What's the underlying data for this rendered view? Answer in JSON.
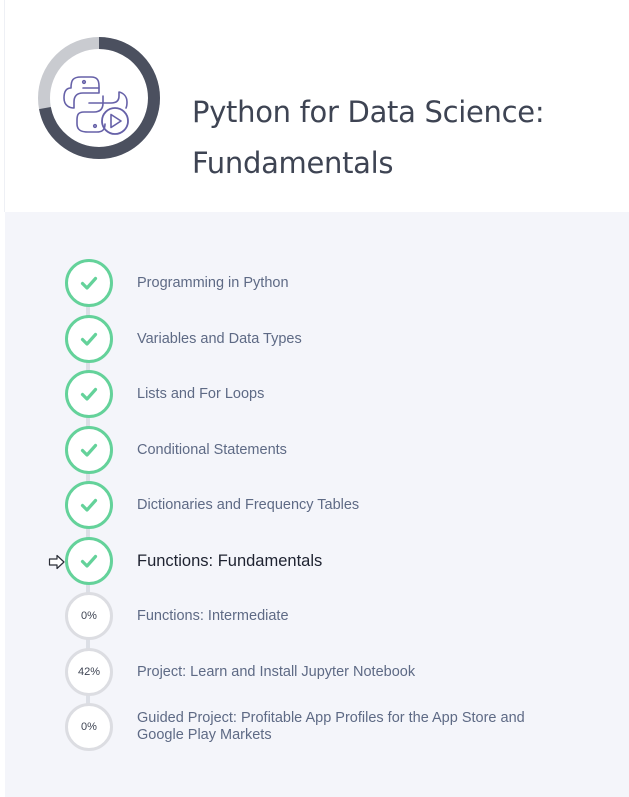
{
  "course": {
    "title_line1": "Python for Data Science:",
    "title_line2": "Fundamentals",
    "progress_fraction": 0.72,
    "colors": {
      "ring_progress": "#4b505f",
      "ring_track": "#c9cbd0",
      "icon_stroke": "#6661a8"
    }
  },
  "steps": [
    {
      "label": "Programming in Python",
      "status": "complete"
    },
    {
      "label": "Variables and Data Types",
      "status": "complete"
    },
    {
      "label": "Lists and For Loops",
      "status": "complete"
    },
    {
      "label": "Conditional Statements",
      "status": "complete"
    },
    {
      "label": "Dictionaries and Frequency Tables",
      "status": "complete"
    },
    {
      "label": "Functions: Fundamentals",
      "status": "complete",
      "current": true
    },
    {
      "label": "Functions: Intermediate",
      "status": "incomplete",
      "progress": "0%"
    },
    {
      "label": "Project: Learn and Install Jupyter Notebook",
      "status": "incomplete",
      "progress": "42%"
    },
    {
      "label": "Guided Project: Profitable App Profiles for the App Store and Google Play Markets",
      "status": "incomplete",
      "progress": "0%"
    }
  ],
  "colors": {
    "complete": "#64d29a",
    "incomplete_border": "#dcdde2",
    "panel_background": "#f4f5fa"
  },
  "icons": {
    "complete": "checkmark-icon",
    "course": "python-video-icon",
    "pointer": "arrow-pointer-icon"
  }
}
